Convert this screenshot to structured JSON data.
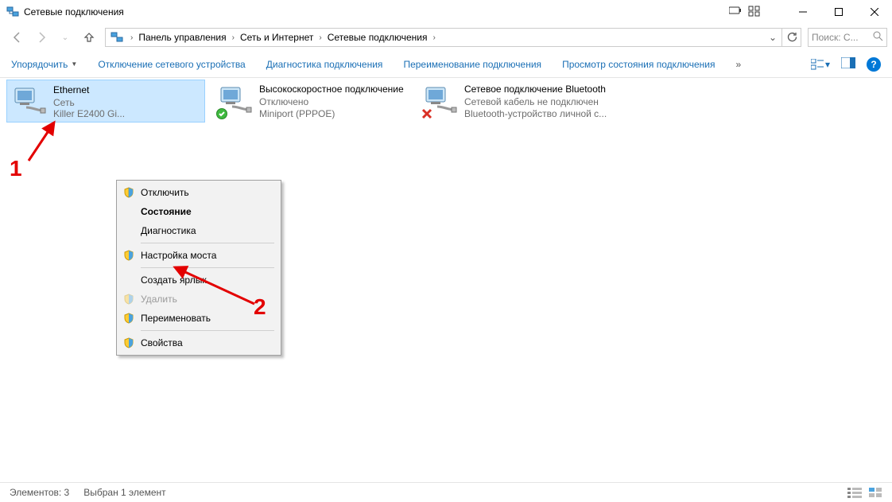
{
  "window": {
    "title": "Сетевые подключения"
  },
  "breadcrumb": {
    "items": [
      "Панель управления",
      "Сеть и Интернет",
      "Сетевые подключения"
    ]
  },
  "search": {
    "placeholder": "Поиск: С..."
  },
  "toolbar": {
    "organize": "Упорядочить",
    "disable": "Отключение сетевого устройства",
    "diagnose": "Диагностика подключения",
    "rename": "Переименование подключения",
    "status": "Просмотр состояния подключения",
    "more": "»"
  },
  "connections": [
    {
      "name": "Ethernet",
      "line2": "Сеть",
      "line3": "Killer E2400 Gi...",
      "selected": true,
      "badge": "none"
    },
    {
      "name": "Высокоскоростное подключение",
      "line2": "Отключено",
      "line3": "Miniport (PPPOE)",
      "selected": false,
      "badge": "ok"
    },
    {
      "name": "Сетевое подключение Bluetooth",
      "line2": "Сетевой кабель не подключен",
      "line3": "Bluetooth-устройство личной с...",
      "selected": false,
      "badge": "x"
    }
  ],
  "context_menu": {
    "items": [
      {
        "label": "Отключить",
        "shield": true,
        "bold": false
      },
      {
        "label": "Состояние",
        "shield": false,
        "bold": true
      },
      {
        "label": "Диагностика",
        "shield": false,
        "bold": false
      },
      {
        "sep": true
      },
      {
        "label": "Настройка моста",
        "shield": true,
        "bold": false
      },
      {
        "sep": true
      },
      {
        "label": "Создать ярлык",
        "shield": false,
        "bold": false
      },
      {
        "label": "Удалить",
        "shield": true,
        "bold": false,
        "disabled": true
      },
      {
        "label": "Переименовать",
        "shield": true,
        "bold": false
      },
      {
        "sep": true
      },
      {
        "label": "Свойства",
        "shield": true,
        "bold": false
      }
    ]
  },
  "annotations": {
    "one": "1",
    "two": "2"
  },
  "statusbar": {
    "count": "Элементов: 3",
    "selected": "Выбран 1 элемент"
  }
}
